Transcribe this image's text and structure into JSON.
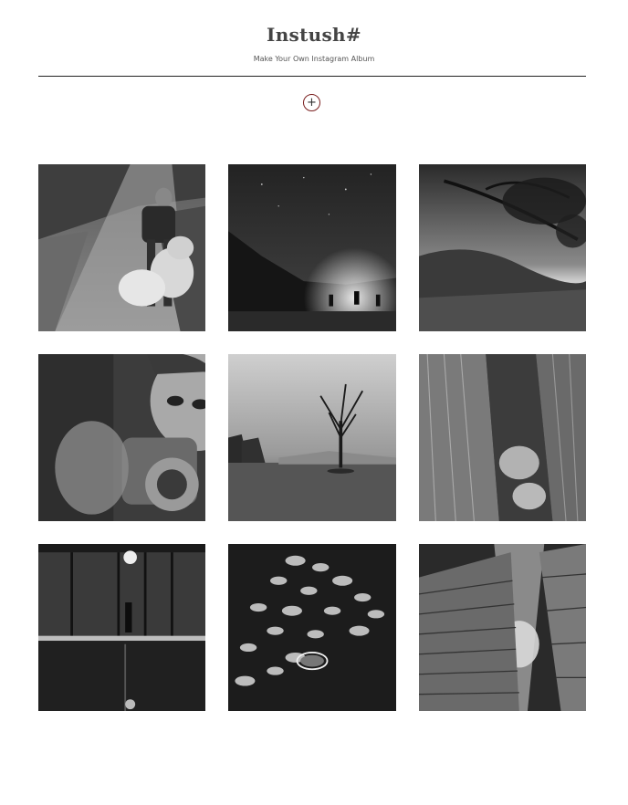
{
  "header": {
    "title": "Instush#",
    "subtitle": "Make Your Own Instagram Album"
  },
  "add_button": {
    "icon": "plus-icon",
    "symbol": "+",
    "accent_color": "#7a1f1f"
  },
  "photos": [
    {
      "name": "photo-girl-with-teddy-bear"
    },
    {
      "name": "photo-campfire-night-sky"
    },
    {
      "name": "photo-tree-branches-sky"
    },
    {
      "name": "photo-boy-with-camera"
    },
    {
      "name": "photo-lone-tree-lake"
    },
    {
      "name": "photo-building-reflection"
    },
    {
      "name": "photo-night-building-reflection"
    },
    {
      "name": "photo-lily-pads"
    },
    {
      "name": "photo-tall-buildings-upward"
    }
  ]
}
